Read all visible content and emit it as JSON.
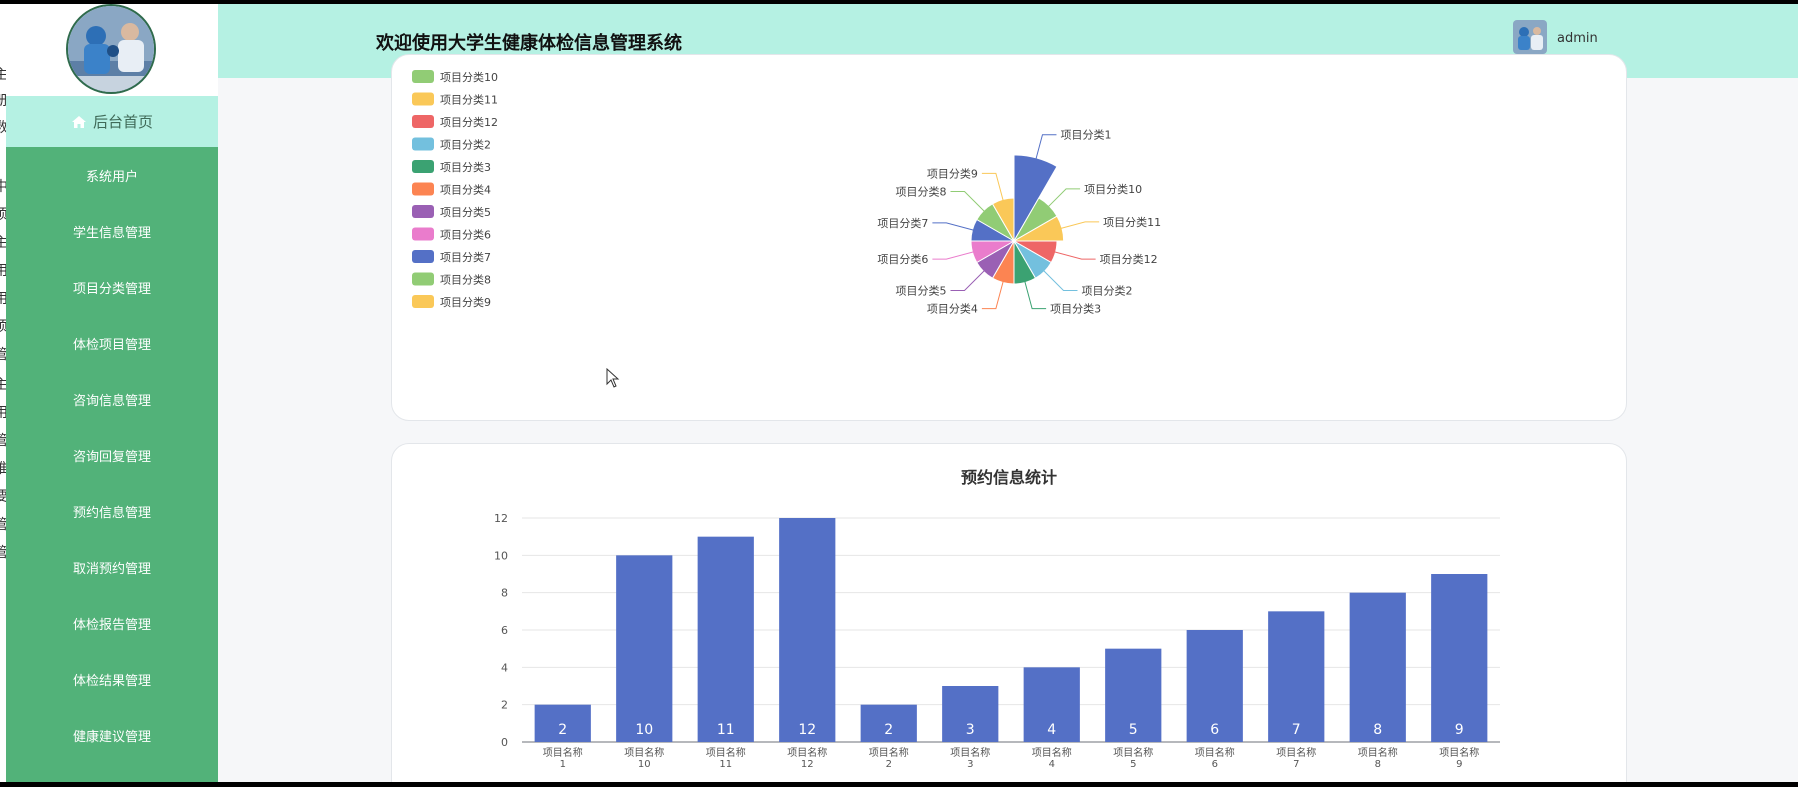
{
  "app": {
    "header_title": "欢迎使用大学生健康体检信息管理系统",
    "username": "admin"
  },
  "edge_fragments": [
    "主",
    "册",
    "数",
    "中",
    "须",
    "主",
    "用",
    "用",
    "须",
    "管",
    "主",
    "用",
    "管",
    "推",
    "要",
    "管",
    "管"
  ],
  "sidebar": {
    "home_label": "后台首页",
    "items": [
      {
        "label": "系统用户"
      },
      {
        "label": "学生信息管理"
      },
      {
        "label": "项目分类管理"
      },
      {
        "label": "体检项目管理"
      },
      {
        "label": "咨询信息管理"
      },
      {
        "label": "咨询回复管理"
      },
      {
        "label": "预约信息管理"
      },
      {
        "label": "取消预约管理"
      },
      {
        "label": "体检报告管理"
      },
      {
        "label": "体检结果管理"
      },
      {
        "label": "健康建议管理"
      }
    ]
  },
  "colors": {
    "header_bg": "#b5f1e3",
    "sidebar_bg": "#52b279",
    "bar_color": "#5470c6"
  },
  "chart_data": [
    {
      "type": "pie",
      "title": "",
      "legend_position": "top-left",
      "legend": [
        "项目分类10",
        "项目分类11",
        "项目分类12",
        "项目分类2",
        "项目分类3",
        "项目分类4",
        "项目分类5",
        "项目分类6",
        "项目分类7",
        "项目分类8",
        "项目分类9"
      ],
      "slices": [
        {
          "name": "项目分类1",
          "value": 12,
          "color": "#5470c6"
        },
        {
          "name": "项目分类10",
          "value": 4,
          "color": "#91cc75"
        },
        {
          "name": "项目分类11",
          "value": 4,
          "color": "#fac858"
        },
        {
          "name": "项目分类12",
          "value": 3,
          "color": "#ee6666"
        },
        {
          "name": "项目分类2",
          "value": 3,
          "color": "#73c0de"
        },
        {
          "name": "项目分类3",
          "value": 3,
          "color": "#3ba272"
        },
        {
          "name": "项目分类4",
          "value": 3,
          "color": "#fc8452"
        },
        {
          "name": "项目分类5",
          "value": 3,
          "color": "#9a60b4"
        },
        {
          "name": "项目分类6",
          "value": 3,
          "color": "#ea7ccc"
        },
        {
          "name": "项目分类7",
          "value": 3,
          "color": "#5470c6"
        },
        {
          "name": "项目分类8",
          "value": 3,
          "color": "#91cc75"
        },
        {
          "name": "项目分类9",
          "value": 3,
          "color": "#fac858"
        }
      ]
    },
    {
      "type": "bar",
      "title": "预约信息统计",
      "categories": [
        "项目名称1",
        "项目名称10",
        "项目名称11",
        "项目名称12",
        "项目名称2",
        "项目名称3",
        "项目名称4",
        "项目名称5",
        "项目名称6",
        "项目名称7",
        "项目名称8",
        "项目名称9"
      ],
      "values": [
        2,
        10,
        11,
        12,
        2,
        3,
        4,
        5,
        6,
        7,
        8,
        9
      ],
      "ylim": [
        0,
        12
      ],
      "yticks": [
        0,
        2,
        4,
        6,
        8,
        10,
        12
      ],
      "grid": true
    }
  ]
}
